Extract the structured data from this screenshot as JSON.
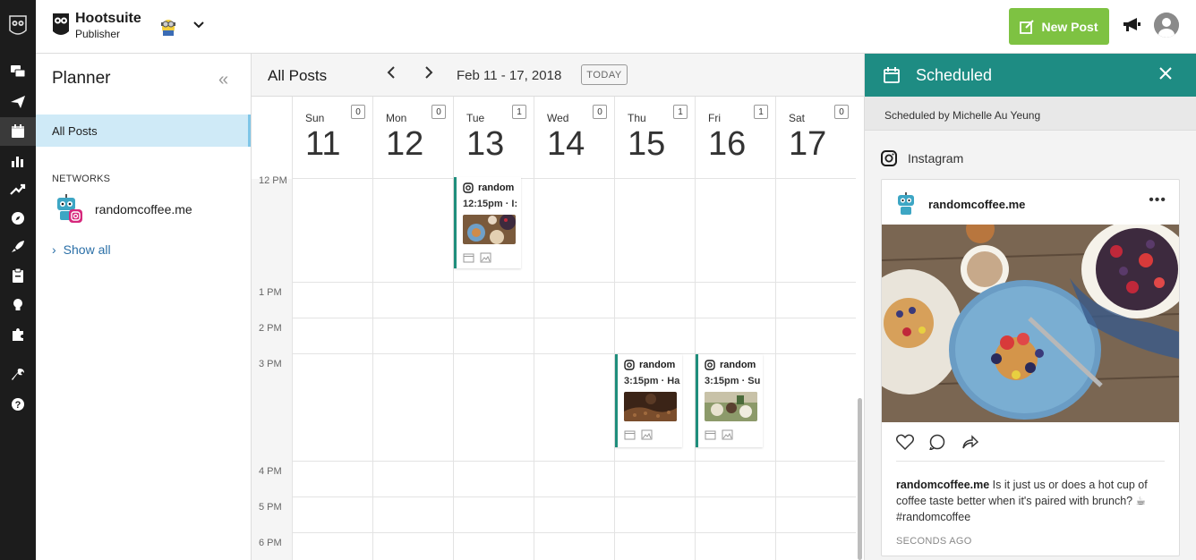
{
  "app": {
    "name": "Hootsuite",
    "module": "Publisher"
  },
  "header": {
    "new_post_label": "New Post"
  },
  "rail": {
    "items": [
      "streams-icon",
      "publisher-icon",
      "planner-icon",
      "analytics-icon",
      "trending-icon",
      "discover-icon",
      "launch-icon",
      "assignments-icon",
      "insights-icon",
      "apps-icon",
      "tools-icon",
      "help-icon"
    ]
  },
  "planner": {
    "title": "Planner",
    "all_posts": "All Posts",
    "networks_label": "NETWORKS",
    "network_name": "randomcoffee.me",
    "show_all": "Show all"
  },
  "calendar": {
    "title": "All Posts",
    "date_range": "Feb 11 - 17, 2018",
    "today_label": "TODAY",
    "days": [
      {
        "name": "Sun",
        "num": "11",
        "count": "0"
      },
      {
        "name": "Mon",
        "num": "12",
        "count": "0"
      },
      {
        "name": "Tue",
        "num": "13",
        "count": "1"
      },
      {
        "name": "Wed",
        "num": "14",
        "count": "0"
      },
      {
        "name": "Thu",
        "num": "15",
        "count": "1"
      },
      {
        "name": "Fri",
        "num": "16",
        "count": "1"
      },
      {
        "name": "Sat",
        "num": "17",
        "count": "0"
      }
    ],
    "times": [
      "12 PM",
      "1 PM",
      "2 PM",
      "3 PM",
      "4 PM",
      "5 PM",
      "6 PM"
    ],
    "posts": [
      {
        "account": "random",
        "time": "12:15pm · I:"
      },
      {
        "account": "random",
        "time": "3:15pm · Ha"
      },
      {
        "account": "random",
        "time": "3:15pm · Su"
      }
    ]
  },
  "scheduled": {
    "title": "Scheduled",
    "scheduled_by": "Scheduled by Michelle Au Yeung",
    "network": "Instagram",
    "account": "randomcoffee.me",
    "caption_account": "randomcoffee.me",
    "caption_text": " Is it just us or does a hot cup of coffee taste better when it's paired with brunch? ☕ #randomcoffee",
    "timestamp": "SECONDS AGO"
  }
}
